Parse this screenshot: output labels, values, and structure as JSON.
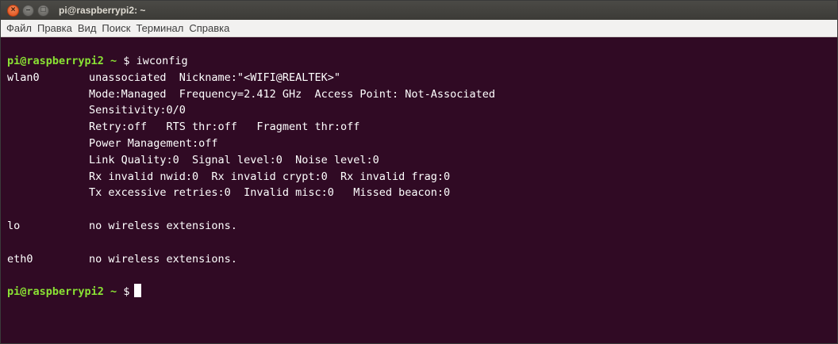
{
  "window": {
    "title": "pi@raspberrypi2: ~",
    "close_glyph": "×",
    "min_glyph": "–",
    "max_glyph": "□"
  },
  "menu": {
    "items": [
      "Файл",
      "Правка",
      "Вид",
      "Поиск",
      "Терминал",
      "Справка"
    ]
  },
  "terminal": {
    "prompt": "pi@raspberrypi2 ~ ",
    "dollar": "$",
    "command": " iwconfig",
    "wlan0": {
      "name": "wlan0",
      "lines": [
        "unassociated  Nickname:\"<WIFI@REALTEK>\"",
        "Mode:Managed  Frequency=2.412 GHz  Access Point: Not-Associated",
        "Sensitivity:0/0",
        "Retry:off   RTS thr:off   Fragment thr:off",
        "Power Management:off",
        "Link Quality:0  Signal level:0  Noise level:0",
        "Rx invalid nwid:0  Rx invalid crypt:0  Rx invalid frag:0",
        "Tx excessive retries:0  Invalid misc:0   Missed beacon:0"
      ]
    },
    "lo": {
      "name": "lo",
      "text": "no wireless extensions."
    },
    "eth0": {
      "name": "eth0",
      "text": "no wireless extensions."
    }
  },
  "colors": {
    "background": "#300a24",
    "prompt": "#8ae234",
    "text": "#ffffff"
  }
}
